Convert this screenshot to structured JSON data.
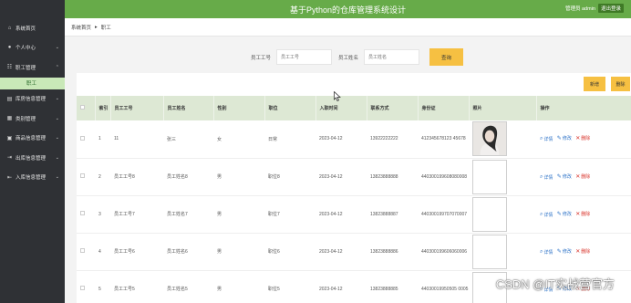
{
  "topbar": {
    "title": "基于Python的仓库管理系统设计",
    "user_label": "管理员 admin",
    "logout_label": "退出登录"
  },
  "sidebar": {
    "items": [
      {
        "label": "系统首页",
        "icon": "home-icon"
      },
      {
        "label": "个人中心",
        "icon": "user-icon"
      },
      {
        "label": "职工管理",
        "icon": "team-icon"
      }
    ],
    "sub_item": "职工",
    "more_items": [
      {
        "label": "库房信息管理",
        "icon": "warehouse-icon"
      },
      {
        "label": "类别管理",
        "icon": "category-icon"
      },
      {
        "label": "商品信息管理",
        "icon": "goods-icon"
      },
      {
        "label": "出库信息管理",
        "icon": "outbound-icon"
      },
      {
        "label": "入库信息管理",
        "icon": "inbound-icon"
      }
    ]
  },
  "breadcrumb": {
    "home": "系统首页",
    "sep": "▸",
    "current": "职工"
  },
  "search": {
    "id_label": "员工工号",
    "id_placeholder": "员工工号",
    "name_label": "员工姓名",
    "name_placeholder": "员工姓名",
    "button": "查询"
  },
  "actions": {
    "add": "新增",
    "delete": "删除"
  },
  "table": {
    "headers": [
      "",
      "索引",
      "员工工号",
      "员工姓名",
      "性别",
      "职位",
      "入职时间",
      "联系方式",
      "身份证",
      "照片",
      "操作"
    ],
    "ops": {
      "detail": "详情",
      "edit": "修改",
      "delete": "删除"
    },
    "rows": [
      {
        "idx": "1",
        "emp_id": "11",
        "name": "张三",
        "gender": "女",
        "position": "日常",
        "date": "2023-04-12",
        "phone": "13922222222",
        "id_card": "412345678123 45678"
      },
      {
        "idx": "2",
        "emp_id": "员工工号8",
        "name": "员工姓名8",
        "gender": "男",
        "position": "职位8",
        "date": "2023-04-12",
        "phone": "13823888888",
        "id_card": "440300199608080008"
      },
      {
        "idx": "3",
        "emp_id": "员工工号7",
        "name": "员工姓名7",
        "gender": "男",
        "position": "职位7",
        "date": "2023-04-12",
        "phone": "13823888887",
        "id_card": "440300199707070007"
      },
      {
        "idx": "4",
        "emp_id": "员工工号6",
        "name": "员工姓名6",
        "gender": "男",
        "position": "职位6",
        "date": "2023-04-12",
        "phone": "13823888886",
        "id_card": "440300199606060006"
      },
      {
        "idx": "5",
        "emp_id": "员工工号5",
        "name": "员工姓名5",
        "gender": "男",
        "position": "职位5",
        "date": "2023-04-12",
        "phone": "13823888885",
        "id_card": "44030019950505 0005"
      }
    ]
  },
  "watermark": "CSDN @IT实战营官方"
}
